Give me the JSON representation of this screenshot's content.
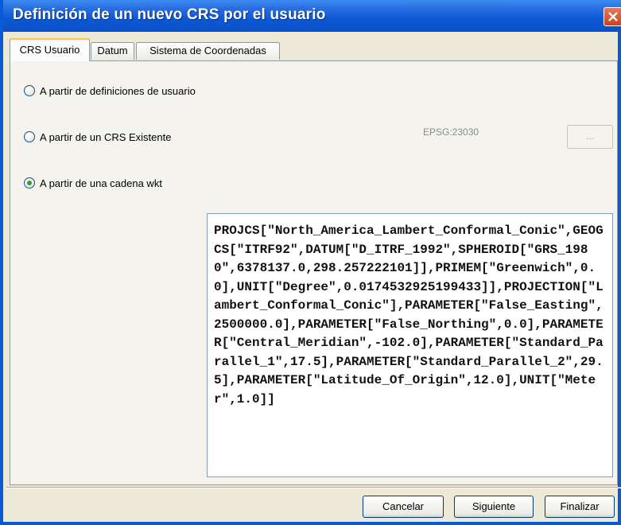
{
  "window": {
    "title": "Definición de un nuevo CRS por el usuario"
  },
  "tabs": [
    {
      "label": "CRS Usuario",
      "active": true
    },
    {
      "label": "Datum",
      "active": false
    },
    {
      "label": "Sistema de Coordenadas",
      "active": false
    }
  ],
  "options": [
    {
      "label": "A partir de definiciones de usuario",
      "selected": false
    },
    {
      "label": "A partir de un CRS Existente",
      "selected": false
    },
    {
      "label": "A partir de una cadena wkt",
      "selected": true
    }
  ],
  "existing_crs": {
    "code": "EPSG:23030",
    "browse_label": "..."
  },
  "wkt_text": "PROJCS[\"North_America_Lambert_Conformal_Conic\",GEOGCS[\"ITRF92\",DATUM[\"D_ITRF_1992\",SPHEROID[\"GRS_1980\",6378137.0,298.257222101]],PRIMEM[\"Greenwich\",0.0],UNIT[\"Degree\",0.0174532925199433]],PROJECTION[\"Lambert_Conformal_Conic\"],PARAMETER[\"False_Easting\",2500000.0],PARAMETER[\"False_Northing\",0.0],PARAMETER[\"Central_Meridian\",-102.0],PARAMETER[\"Standard_Parallel_1\",17.5],PARAMETER[\"Standard_Parallel_2\",29.5],PARAMETER[\"Latitude_Of_Origin\",12.0],UNIT[\"Meter\",1.0]]",
  "buttons": {
    "cancel": "Cancelar",
    "next": "Siguiente",
    "finish": "Finalizar"
  },
  "colors": {
    "titlebar": "#0a58d4",
    "active_tab_accent": "#ffc83c",
    "selected_radio": "#3a9a30"
  }
}
